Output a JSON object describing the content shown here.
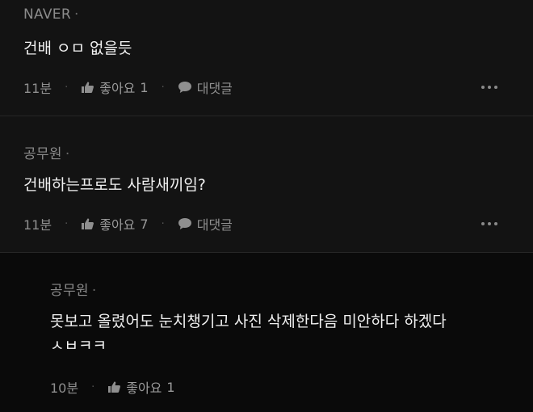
{
  "comments": [
    {
      "author": "NAVER",
      "dot": "·",
      "text": "건배 ㅇㅁ 없을듯",
      "time": "11분",
      "like_label": "좋아요",
      "like_count": "1",
      "reply_label": "대댓글",
      "more_icon": "more-horizontal-icon"
    },
    {
      "author": "공무원",
      "dot": "·",
      "text": "건배하는프로도 사람새끼임?",
      "time": "11분",
      "like_label": "좋아요",
      "like_count": "7",
      "reply_label": "대댓글",
      "more_icon": "more-horizontal-icon"
    },
    {
      "author": "공무원",
      "dot": "·",
      "text_line1": "못보고 올렸어도 눈치챙기고 사진 삭제한다음 미안하다 하겠다",
      "text_line2": "ㅅㅂㅋㅋ",
      "time": "10분",
      "like_label": "좋아요",
      "like_count": "1"
    }
  ],
  "meta_separator": "·",
  "icons": {
    "like": "thumbs-up-icon",
    "reply": "speech-bubble-icon",
    "more": "more-horizontal-icon"
  }
}
